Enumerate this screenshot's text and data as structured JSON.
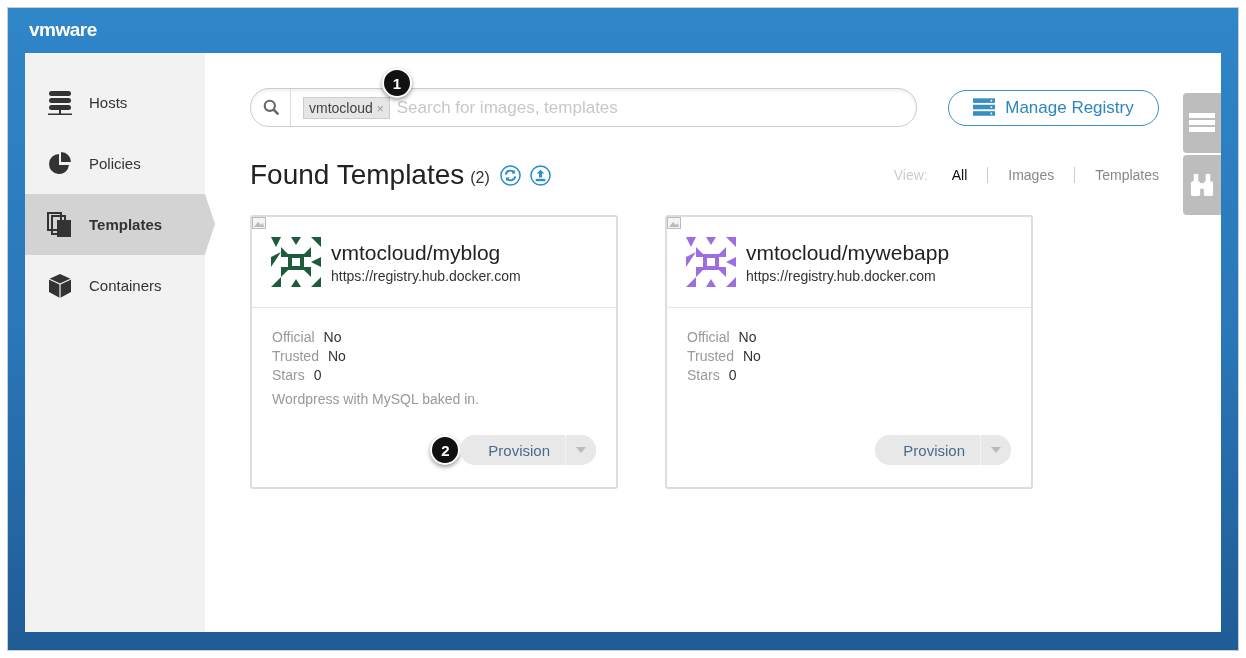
{
  "header": {
    "logo": "vmware"
  },
  "sidebar": {
    "items": [
      {
        "label": "Hosts",
        "kind": "hosts",
        "selected": false
      },
      {
        "label": "Policies",
        "kind": "policies",
        "selected": false
      },
      {
        "label": "Templates",
        "kind": "templates",
        "selected": true
      },
      {
        "label": "Containers",
        "kind": "containers",
        "selected": false
      }
    ]
  },
  "search": {
    "tag": "vmtocloud",
    "tag_remove": "×",
    "placeholder": "Search for images, templates",
    "callout": "1"
  },
  "manage_button": "Manage Registry",
  "heading": {
    "title": "Found Templates",
    "count": "(2)"
  },
  "view_filter": {
    "label": "View:",
    "options": [
      {
        "label": "All",
        "selected": true
      },
      {
        "label": "Images",
        "selected": false
      },
      {
        "label": "Templates",
        "selected": false
      }
    ]
  },
  "cards": [
    {
      "name": "vmtocloud/myblog",
      "registry": "https://registry.hub.docker.com",
      "color": "#1e5b3a",
      "fields": [
        {
          "label": "Official",
          "value": "No"
        },
        {
          "label": "Trusted",
          "value": "No"
        },
        {
          "label": "Stars",
          "value": "0"
        }
      ],
      "description": "Wordpress with MySQL baked in.",
      "button": "Provision",
      "callout": "2"
    },
    {
      "name": "vmtocloud/mywebapp",
      "registry": "https://registry.hub.docker.com",
      "color": "#9b6fe0",
      "fields": [
        {
          "label": "Official",
          "value": "No"
        },
        {
          "label": "Trusted",
          "value": "No"
        },
        {
          "label": "Stars",
          "value": "0"
        }
      ],
      "button": "Provision"
    }
  ]
}
